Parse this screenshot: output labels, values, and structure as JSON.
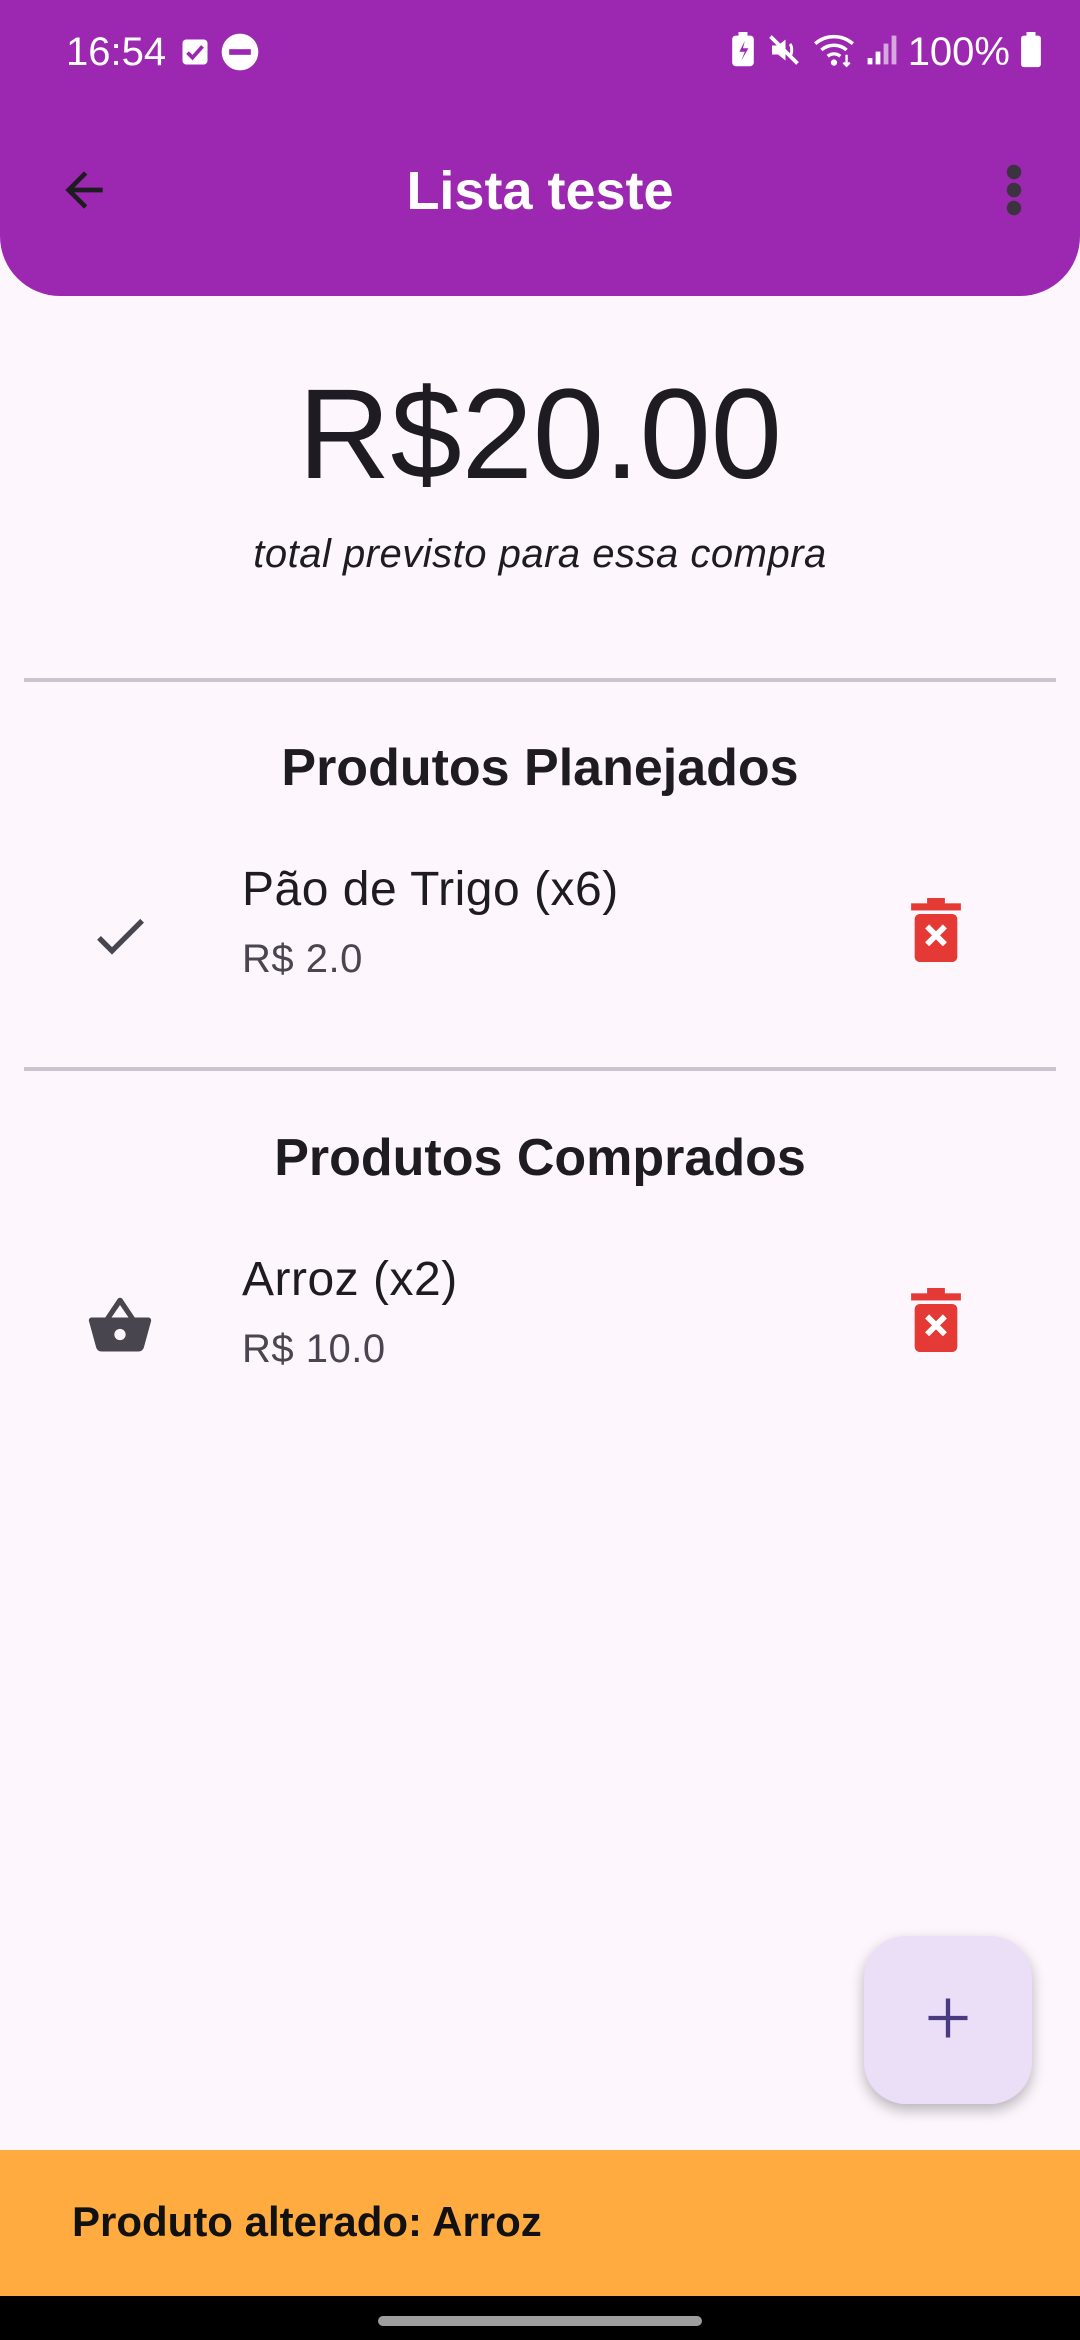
{
  "status_bar": {
    "time": "16:54",
    "battery_percent": "100%",
    "left_icons": [
      "check-box-icon",
      "do-not-disturb-icon"
    ],
    "right_icons": [
      "battery-saver-icon",
      "mute-icon",
      "wifi-icon",
      "signal-icon",
      "battery-icon"
    ]
  },
  "app_bar": {
    "title": "Lista teste",
    "back_icon": "arrow-back-icon",
    "menu_icon": "more-vert-icon",
    "color": "#9c27b0"
  },
  "summary": {
    "total": "R$20.00",
    "caption": "total previsto para essa compra"
  },
  "planned": {
    "title": "Produtos Planejados",
    "items": [
      {
        "name": "Pão de Trigo (x6)",
        "price": "R$ 2.0",
        "icon": "check-icon"
      }
    ]
  },
  "purchased": {
    "title": "Produtos Comprados",
    "items": [
      {
        "name": "Arroz (x2)",
        "price": "R$ 10.0",
        "icon": "shopping-basket-icon"
      }
    ]
  },
  "fab": {
    "icon": "plus-icon"
  },
  "snackbar": {
    "text": "Produto alterado: Arroz",
    "color": "#ffab40"
  },
  "colors": {
    "delete": "#e53935",
    "background": "#fdf7fd"
  }
}
